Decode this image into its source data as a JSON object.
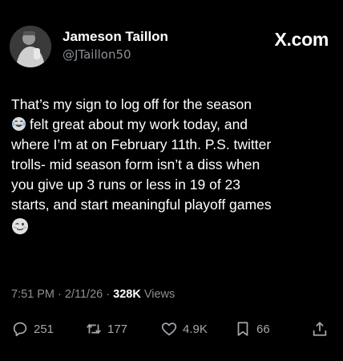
{
  "author": {
    "display_name": "Jameson Taillon",
    "handle": "@JTaillon50"
  },
  "brand": "X.com",
  "tweet": {
    "line1": "That’s my sign to log off for the season",
    "line2": "felt great about my work today, and",
    "line3": "where I’m at on February 11th. P.S. twitter",
    "line4": "trolls- mid season form isn’t a diss when",
    "line5": "you give up 3 runs or less in 19 of 23",
    "line6": "starts, and start meaningful playoff games",
    "emoji_1": "laughing-crying-emoji",
    "emoji_2": "winking-face-emoji"
  },
  "meta": {
    "time": "7:51 PM",
    "separator": "·",
    "date": "2/11/26",
    "views_count": "328K",
    "views_label": "Views"
  },
  "actions": {
    "replies": "251",
    "reposts": "177",
    "likes": "4.9K",
    "bookmarks": "66",
    "icons": [
      "reply-icon",
      "repost-icon",
      "like-icon",
      "bookmark-icon",
      "share-icon"
    ]
  }
}
